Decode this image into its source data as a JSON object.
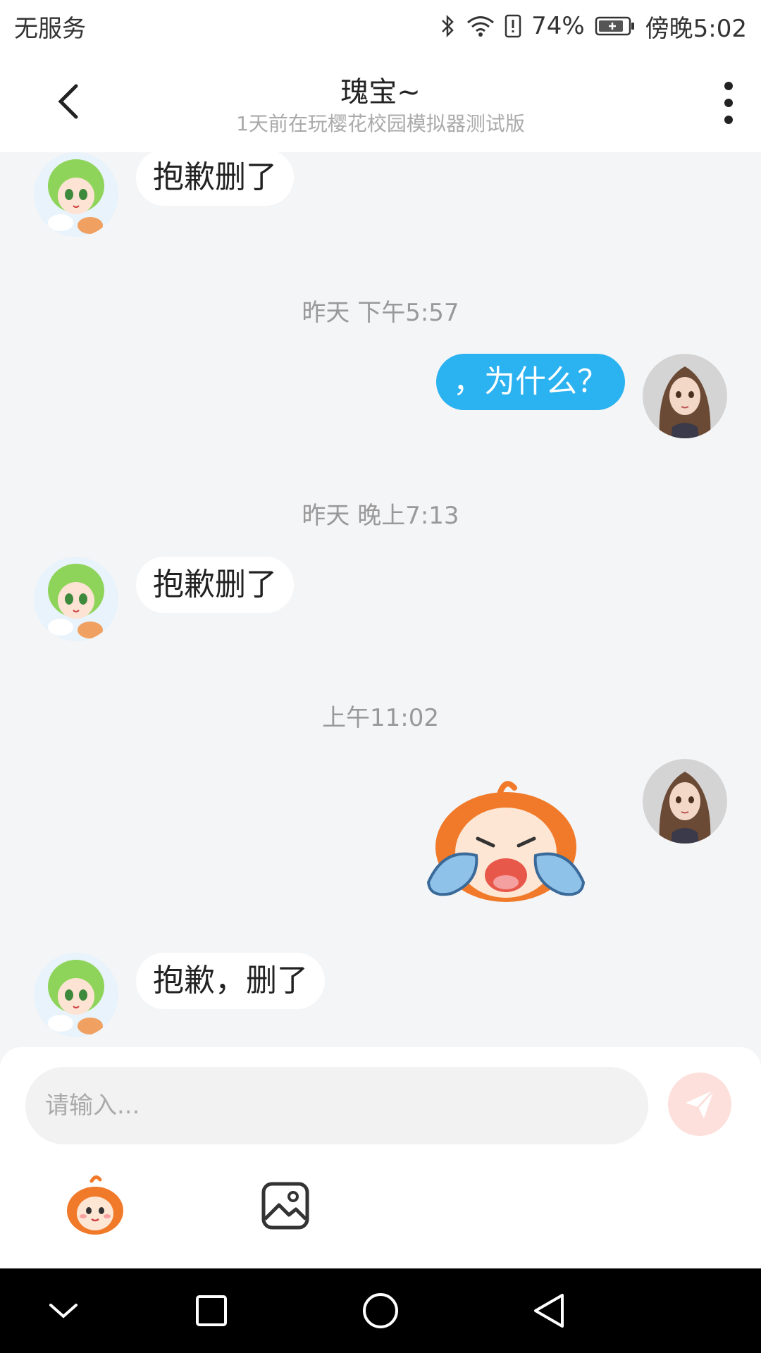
{
  "status_bar": {
    "carrier": "无服务",
    "battery_percent": "74%",
    "time": "傍晚5:02",
    "icons": [
      "bluetooth-icon",
      "wifi-icon",
      "alert-icon",
      "battery-icon"
    ]
  },
  "header": {
    "title": "瑰宝~",
    "subtitle": "1天前在玩樱花校园模拟器测试版",
    "back_icon": "chevron-left-icon",
    "more_icon": "more-vertical-icon"
  },
  "messages": [
    {
      "type": "text",
      "side": "left",
      "avatar": "green-hair-girl-avatar",
      "text": "抱歉删了"
    },
    {
      "type": "timestamp",
      "text": "昨天 下午5:57"
    },
    {
      "type": "text",
      "side": "right",
      "avatar": "brown-hair-girl-avatar",
      "text": "，为什么？"
    },
    {
      "type": "timestamp",
      "text": "昨天 晚上7:13"
    },
    {
      "type": "text",
      "side": "left",
      "avatar": "green-hair-girl-avatar",
      "text": "抱歉删了"
    },
    {
      "type": "timestamp",
      "text": "上午11:02"
    },
    {
      "type": "sticker",
      "side": "right",
      "avatar": "brown-hair-girl-avatar",
      "sticker": "crying-mascot-sticker"
    },
    {
      "type": "text",
      "side": "left",
      "avatar": "green-hair-girl-avatar",
      "text": "抱歉，删了"
    }
  ],
  "input": {
    "placeholder": "请输入...",
    "value": "",
    "send_icon": "send-icon"
  },
  "toolbar": {
    "items": [
      "sticker-picker-icon",
      "image-picker-icon"
    ]
  },
  "nav_bar": {
    "items": [
      "collapse-icon",
      "recents-icon",
      "home-icon",
      "back-icon"
    ]
  },
  "colors": {
    "accent": "#2bb2f0",
    "background": "#f4f5f7",
    "send_button": "#fde0dc"
  }
}
